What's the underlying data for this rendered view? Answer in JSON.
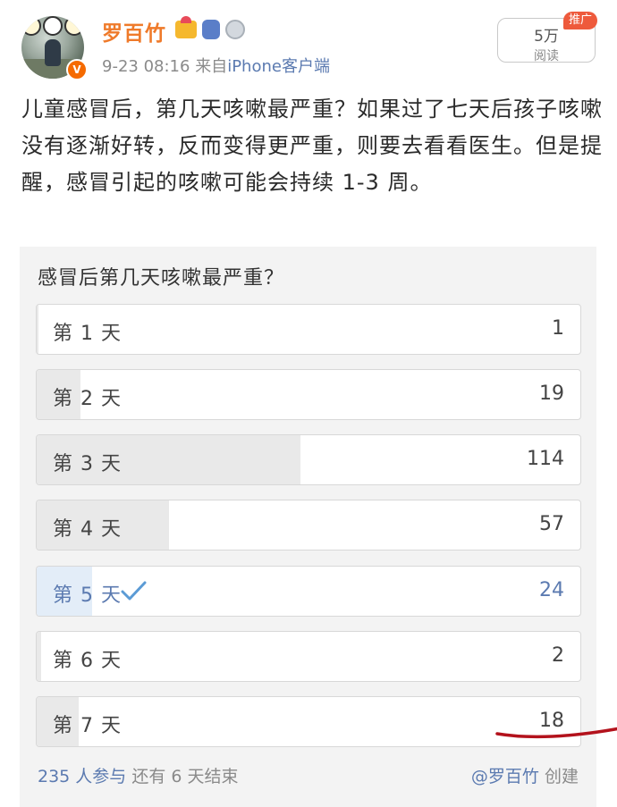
{
  "header": {
    "username": "罗百竹",
    "verified_badge": "V",
    "time": "9-23 08:16",
    "source_prefix": "来自",
    "source": "iPhone客户端",
    "read_count": "5万",
    "read_label": "阅读",
    "promo_badge": "推广",
    "icons": [
      "cartoon-sticker-icon",
      "crown-badge-icon",
      "backpack-badge-icon",
      "medal-badge-icon"
    ]
  },
  "post": {
    "text": "儿童感冒后，第几天咳嗽最严重？如果过了七天后孩子咳嗽没有逐渐好转，反而变得更严重，则要去看看医生。但是提醒，感冒引起的咳嗽可能会持续 1-3 周。"
  },
  "poll": {
    "question": "感冒后第几天咳嗽最严重？",
    "options": [
      {
        "label": "第 1 天",
        "count": "1",
        "share": 0.004
      },
      {
        "label": "第 2 天",
        "count": "19",
        "share": 0.081
      },
      {
        "label": "第 3 天",
        "count": "114",
        "share": 0.485
      },
      {
        "label": "第 4 天",
        "count": "57",
        "share": 0.243
      },
      {
        "label": "第 5 天",
        "count": "24",
        "share": 0.102,
        "selected": true
      },
      {
        "label": "第 6 天",
        "count": "2",
        "share": 0.009
      },
      {
        "label": "第 7 天",
        "count": "18",
        "share": 0.077
      }
    ],
    "participants": "235 人参与",
    "remaining": "还有 6 天结束",
    "creator": "@罗百竹",
    "creator_suffix": "创建"
  },
  "colors": {
    "username": "#ef7a2a",
    "link": "#5b7ab0",
    "bar_fill": "#e9e9e9",
    "selected_fill": "#e3edf8",
    "annotation": "#b3121c",
    "promo": "#ee5a3c"
  }
}
